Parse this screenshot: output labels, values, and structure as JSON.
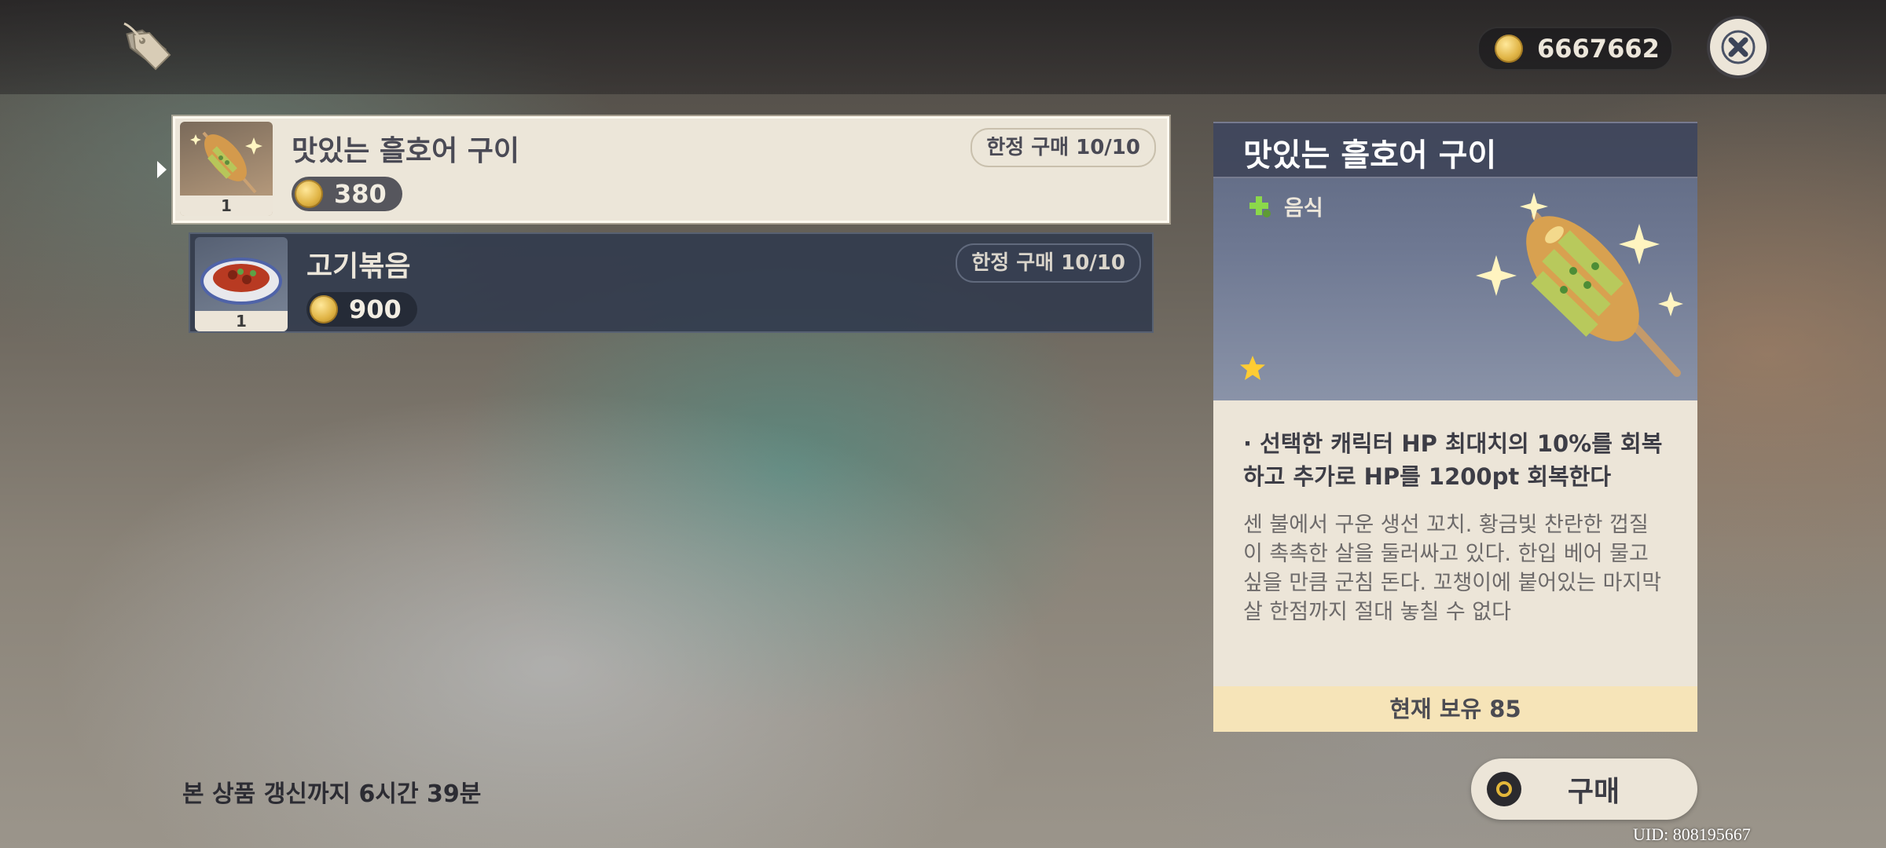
{
  "header": {
    "currency_value": "6667662",
    "currency_icon": "mora-coin-icon",
    "close_icon": "close-icon",
    "shop_icon": "price-tag-icon"
  },
  "items": [
    {
      "name": "맛있는 흘호어 구이",
      "qty": "1",
      "price": "380",
      "limit": "한정 구매 10/10",
      "selected": true,
      "icon": "grilled-fish-skewer-icon"
    },
    {
      "name": "고기볶음",
      "qty": "1",
      "price": "900",
      "limit": "한정 구매 10/10",
      "selected": false,
      "icon": "stir-fried-meat-icon"
    }
  ],
  "refresh_text": "본 상품 갱신까지 6시간 39분",
  "detail": {
    "title": "맛있는 흘호어 구이",
    "category": "음식",
    "rarity_stars": 1,
    "effect": "· 선택한 캐릭터 HP 최대치의 10%를 회복하고 추가로 HP를 1200pt 회복한다",
    "flavor": "센 불에서 구운 생선 꼬치. 황금빛 찬란한 껍질이 촉촉한 살을 둘러싸고 있다. 한입 베어 물고 싶을 만큼 군침 돈다. 꼬챙이에 붙어있는 마지막 살 한점까지 절대 놓칠 수 없다",
    "owned": "현재 보유 85"
  },
  "buy_label": "구매",
  "uid": "UID: 808195667",
  "colors": {
    "panel_light": "#ece5d8",
    "panel_dark": "#30394c",
    "gold": "#e3b73a",
    "owned_bar": "#f6e4b8"
  }
}
